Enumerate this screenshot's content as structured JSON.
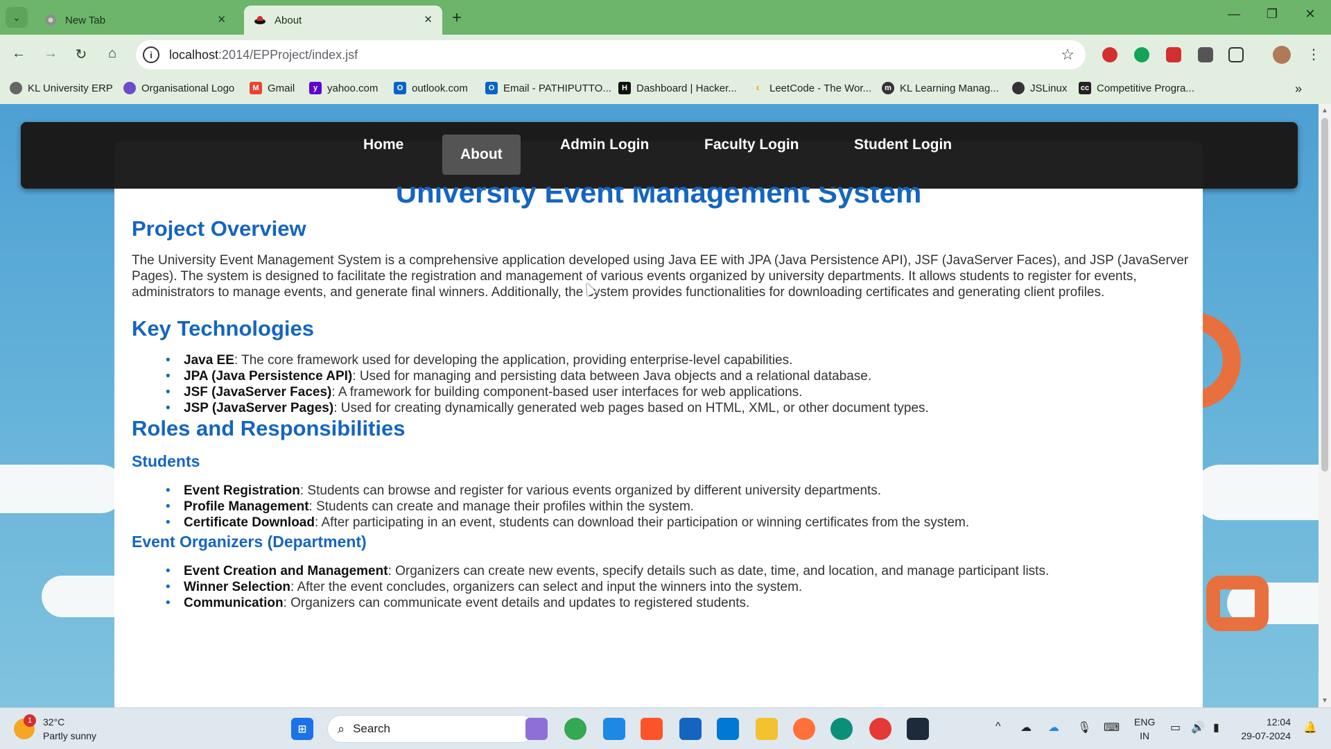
{
  "browser": {
    "tabs": [
      {
        "title": "New Tab",
        "active": false
      },
      {
        "title": "About",
        "active": true
      }
    ],
    "url_host": "localhost",
    "url_path": ":2014/EPProject/index.jsf",
    "bookmarks": [
      "KL University ERP",
      "Organisational Logo",
      "Gmail",
      "yahoo.com",
      "outlook.com",
      "Email - PATHIPUTTO...",
      "Dashboard | Hacker...",
      "LeetCode - The Wor...",
      "KL Learning Manag...",
      "JSLinux",
      "Competitive Progra..."
    ]
  },
  "nav": {
    "items": [
      "Home",
      "About",
      "Admin Login",
      "Faculty Login",
      "Student Login"
    ],
    "active": "About"
  },
  "page": {
    "title": "University Event Management System",
    "overview_heading": "Project Overview",
    "overview_text": "The University Event Management System is a comprehensive application developed using Java EE with JPA (Java Persistence API), JSF (JavaServer Faces), and JSP (JavaServer Pages). The system is designed to facilitate the registration and management of various events organized by university departments. It allows students to register for events, administrators to manage events, and generate final winners. Additionally, the system provides functionalities for downloading certificates and generating client profiles.",
    "tech_heading": "Key Technologies",
    "technologies": [
      {
        "term": "Java EE",
        "desc": ": The core framework used for developing the application, providing enterprise-level capabilities."
      },
      {
        "term": "JPA (Java Persistence API)",
        "desc": ": Used for managing and persisting data between Java objects and a relational database."
      },
      {
        "term": "JSF (JavaServer Faces)",
        "desc": ": A framework for building component-based user interfaces for web applications."
      },
      {
        "term": "JSP (JavaServer Pages)",
        "desc": ": Used for creating dynamically generated web pages based on HTML, XML, or other document types."
      }
    ],
    "roles_heading": "Roles and Responsibilities",
    "students_heading": "Students",
    "students": [
      {
        "term": "Event Registration",
        "desc": ": Students can browse and register for various events organized by different university departments."
      },
      {
        "term": "Profile Management",
        "desc": ": Students can create and manage their profiles within the system."
      },
      {
        "term": "Certificate Download",
        "desc": ": After participating in an event, students can download their participation or winning certificates from the system."
      }
    ],
    "organizers_heading": "Event Organizers (Department)",
    "organizers": [
      {
        "term": "Event Creation and Management",
        "desc": ": Organizers can create new events, specify details such as date, time, and location, and manage participant lists."
      },
      {
        "term": "Winner Selection",
        "desc": ": After the event concludes, organizers can select and input the winners into the system."
      },
      {
        "term": "Communication",
        "desc": ": Organizers can communicate event details and updates to registered students."
      }
    ]
  },
  "taskbar": {
    "weather_temp": "32°C",
    "weather_desc": "Partly sunny",
    "weather_badge": "1",
    "search_label": "Search",
    "lang_1": "ENG",
    "lang_2": "IN",
    "time": "12:04",
    "date": "29-07-2024"
  },
  "colors": {
    "chrome_frame": "#6cb56a",
    "chrome_toolbar": "#e2efe0",
    "heading_blue": "#1565c0",
    "navbar": "#1b1b1b"
  }
}
